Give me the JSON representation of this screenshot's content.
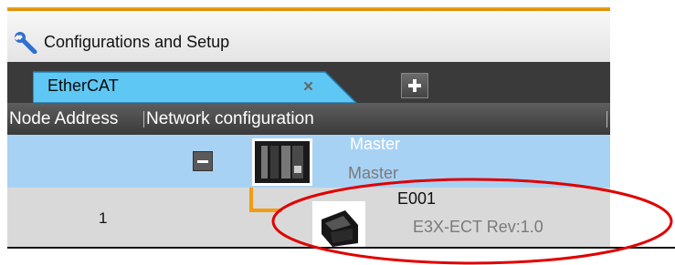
{
  "window": {
    "title": "Configurations and Setup",
    "icon": "wrench-icon"
  },
  "tabs": [
    {
      "label": "EtherCAT",
      "close": "×"
    }
  ],
  "add_tab": {
    "icon": "plus-icon"
  },
  "columns": {
    "node_address": "Node Address",
    "network_configuration": "Network configuration"
  },
  "master": {
    "name": "Master",
    "model": "Master",
    "icon": "master-device-icon",
    "toggle_icon": "minus-icon"
  },
  "slaves": [
    {
      "node_address": "1",
      "name": "E001",
      "model": "E3X-ECT Rev:1.0",
      "icon": "slave-device-icon"
    }
  ],
  "colors": {
    "accent": "#f39c12",
    "tab_fill": "#5ec7f4",
    "master_row": "#a8d2f4",
    "annotation": "#e00000"
  }
}
